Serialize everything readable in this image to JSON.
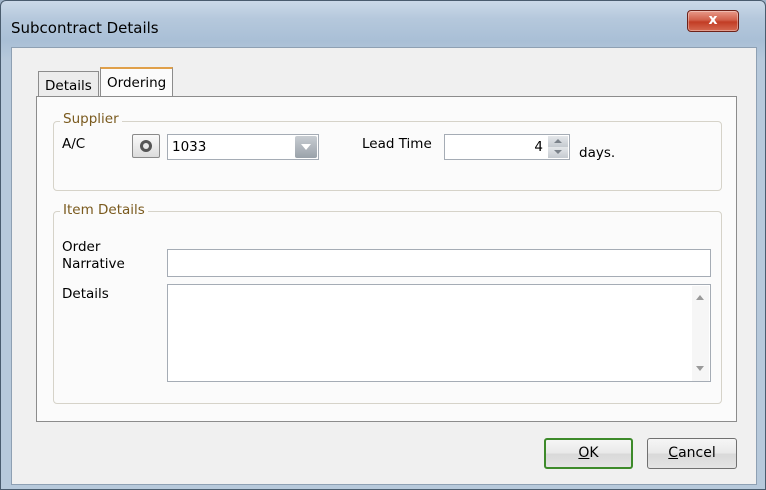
{
  "window": {
    "title": "Subcontract Details",
    "close_glyph": "x"
  },
  "tabs": [
    {
      "label": "Details",
      "active": false
    },
    {
      "label": "Ordering",
      "active": true
    }
  ],
  "supplier": {
    "legend": "Supplier",
    "account_label": "A/C",
    "account_value": "1033",
    "lead_time_label": "Lead Time",
    "lead_time_value": "4",
    "lead_time_unit": "days."
  },
  "item_details": {
    "legend": "Item Details",
    "order_narrative_label_line1": "Order",
    "order_narrative_label_line2": "Narrative",
    "order_narrative_value": "",
    "details_label": "Details",
    "details_value": ""
  },
  "buttons": {
    "ok_underlined": "O",
    "ok_rest": "K",
    "cancel_underlined": "C",
    "cancel_rest": "ancel"
  },
  "icons": {
    "lookup": "lookup-icon",
    "combo": "chevron-down-icon",
    "spin_up": "spin-up-icon",
    "spin_down": "spin-down-icon",
    "close": "close-icon"
  },
  "colors": {
    "legend_text": "#7a5a1e",
    "ok_border": "#3d8a2a",
    "close_button": "#c23c24",
    "active_tab_accent": "#e0a04a"
  }
}
